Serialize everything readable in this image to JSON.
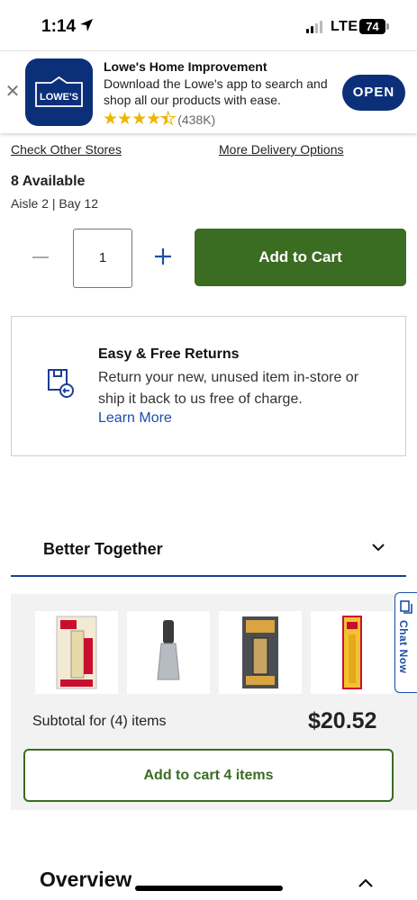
{
  "status_bar": {
    "time": "1:14",
    "network": "LTE",
    "battery": "74"
  },
  "app_banner": {
    "title": "Lowe's Home Improvement",
    "description": "Download the Lowe's app to search and shop all our products with ease.",
    "logo_text": "LOWE'S",
    "rating_count": "(438K)",
    "rating_stars": 4.5,
    "open_label": "OPEN",
    "brand_color": "#0c2f7a"
  },
  "store": {
    "check_other_stores": "Check Other Stores",
    "more_delivery_options": "More Delivery Options",
    "availability": "8 Available",
    "location": "Aisle 2 | Bay 12"
  },
  "purchase": {
    "quantity": "1",
    "add_to_cart_label": "Add to Cart",
    "accent_color": "#3a6c22"
  },
  "returns": {
    "title": "Easy & Free Returns",
    "description": "Return your new, unused item in-store or ship it back to us free of charge.",
    "link_label": "Learn More"
  },
  "better_together": {
    "title": "Better Together",
    "items": [
      {
        "icon": "epoxy-syringe-product-image"
      },
      {
        "icon": "putty-knife-product-image"
      },
      {
        "icon": "tank-bond-epoxy-product-image"
      },
      {
        "icon": "epoxy-stick-product-image"
      }
    ],
    "subtotal_label": "Subtotal for (4) items",
    "subtotal_price": "$20.52",
    "add_all_label": "Add to cart 4 items"
  },
  "chat": {
    "label": "Chat Now"
  },
  "overview": {
    "title": "Overview"
  }
}
